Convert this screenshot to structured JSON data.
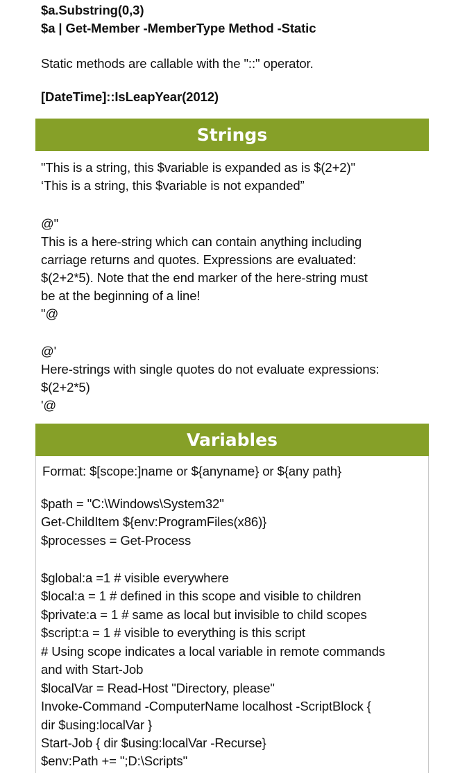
{
  "top": {
    "lines": [
      "$a.Substring(0,3)",
      "$a | Get-Member -MemberType Method -Static"
    ],
    "static_note": "Static methods are callable with the \"::\" operator.",
    "example": "[DateTime]::IsLeapYear(2012)"
  },
  "strings": {
    "title": "Strings",
    "lines": [
      "\"This is a string, this $variable is expanded as is $(2+2)\"",
      "‘This is a string, this $variable is not expanded”",
      "@\"",
      "This is a here-string which can contain anything including",
      "carriage returns and quotes. Expressions are evaluated:",
      "$(2+2*5). Note that the end marker of the here-string must",
      "be at the beginning of a line!",
      "\"@",
      "@'",
      "Here-strings with single quotes do not evaluate expressions:",
      "$(2+2*5)",
      "'@"
    ]
  },
  "variables": {
    "title": "Variables",
    "lines": [
      "Format: $[scope:]name or ${anyname} or ${any path}",
      "$path = \"C:\\Windows\\System32\"",
      "Get-ChildItem ${env:ProgramFiles(x86)}",
      "$processes = Get-Process",
      "$global:a =1 # visible everywhere",
      "$local:a = 1 # defined in this scope and visible to children",
      "$private:a = 1 # same as local but invisible to child scopes",
      "$script:a = 1 # visible to everything is this script",
      "# Using scope indicates a local variable in remote commands",
      "and with Start-Job",
      "$localVar = Read-Host \"Directory, please\"",
      "Invoke-Command -ComputerName localhost -ScriptBlock {",
      "dir $using:localVar }",
      "Start-Job { dir $using:localVar -Recurse}",
      "$env:Path += \";D:\\Scripts\""
    ]
  }
}
